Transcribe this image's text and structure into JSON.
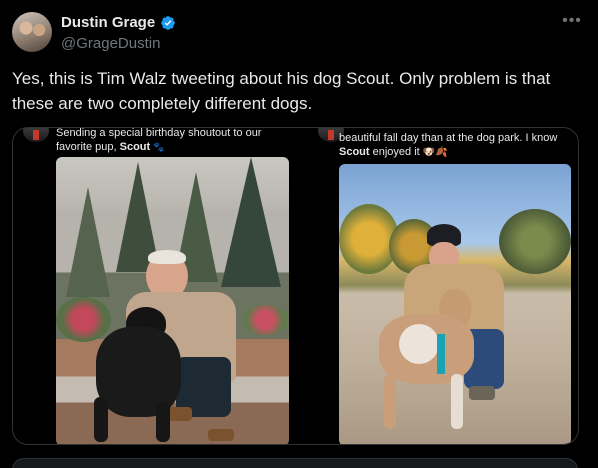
{
  "author": {
    "name": "Dustin Grage",
    "handle": "@GrageDustin"
  },
  "tweet": {
    "text": "Yes, this is Tim Walz tweeting about his dog Scout. Only problem is that these are two completely different dogs."
  },
  "quoted_left": {
    "caption_line1": "Sending a special birthday shoutout to our",
    "caption_line2_prefix": "favorite pup,",
    "caption_bold": "Scout",
    "caption_emoji": "🐾"
  },
  "quoted_right": {
    "caption_line1": "beautiful fall day than at the dog park. I know",
    "caption_bold": "Scout",
    "caption_line2_suffix": "enjoyed it",
    "caption_emoji": "🐶🍂"
  },
  "icons": {
    "verified": "verified-badge-icon",
    "more": "more-options-icon"
  },
  "colors": {
    "background": "#000000",
    "text": "#e7e9ea",
    "secondary": "#71767b",
    "border": "#2f3336",
    "verified": "#1d9bf0"
  }
}
